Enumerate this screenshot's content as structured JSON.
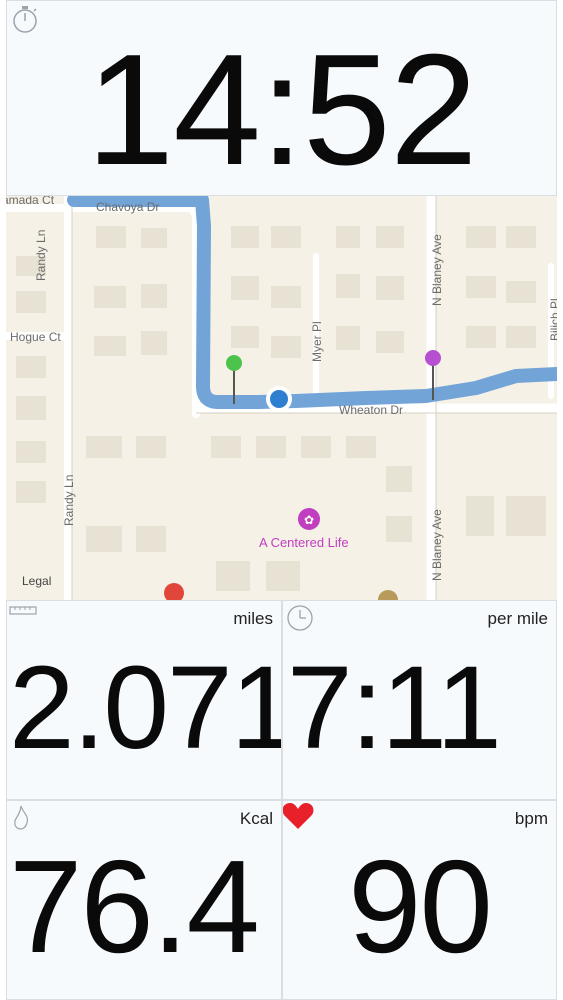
{
  "timer": {
    "icon": "stopwatch-icon",
    "value": "14:52"
  },
  "map": {
    "streets": [
      "Chavoya Dr",
      "Randy Ln",
      "Hogue Ct",
      "Myer Pl",
      "N Blaney Ave",
      "Wheaton Dr",
      "Bilich Pl"
    ],
    "street_label_top_left": "amada Ct",
    "poi": {
      "name": "A Centered Life",
      "icon": "yoga-icon",
      "color": "#c03fc0"
    },
    "legal": "Legal",
    "route_color": "#6a9fd6",
    "start_pin_color": "#4cc44c",
    "end_pin_color": "#b64fd0"
  },
  "metrics": {
    "distance": {
      "icon": "ruler-icon",
      "unit": "miles",
      "value": "2.0717"
    },
    "pace": {
      "icon": "clock-icon",
      "unit": "per mile",
      "value": "7:11"
    },
    "calories": {
      "icon": "flame-icon",
      "unit": "Kcal",
      "value": "76.4"
    },
    "heart_rate": {
      "icon": "heart-icon",
      "unit": "bpm",
      "value": "90",
      "icon_color": "#e8202a"
    }
  }
}
